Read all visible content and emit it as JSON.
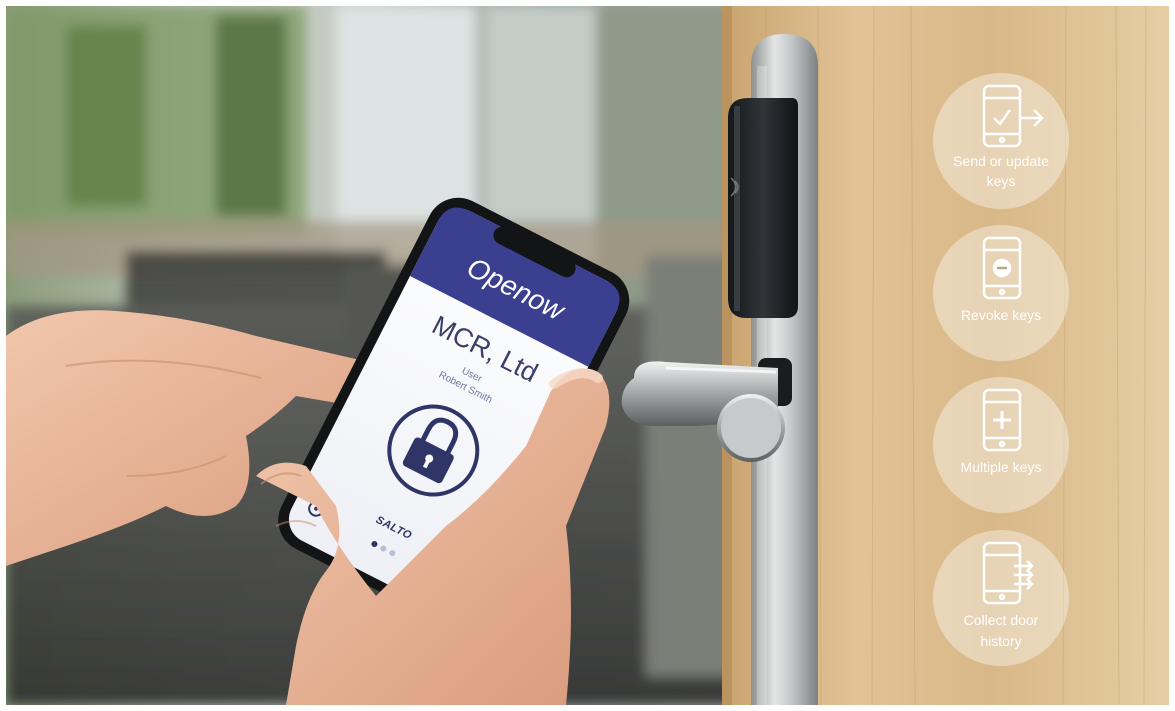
{
  "phone": {
    "brand": "Openow",
    "company": "MCR, Ltd",
    "user_label": "User",
    "user_name": "Robert Smith",
    "footer_brand": "SALTO"
  },
  "features": [
    {
      "icon": "phone-send-icon",
      "line1": "Send or update",
      "line2": "keys"
    },
    {
      "icon": "phone-revoke-icon",
      "line1": "Revoke keys",
      "line2": ""
    },
    {
      "icon": "phone-add-icon",
      "line1": "Multiple keys",
      "line2": ""
    },
    {
      "icon": "phone-history-icon",
      "line1": "Collect door",
      "line2": "history"
    }
  ],
  "colors": {
    "app_header": "#3b3f8f",
    "lock_ring": "#2f3566",
    "door_wood": "#d9b98a",
    "badge_bg": "#ffffff"
  }
}
